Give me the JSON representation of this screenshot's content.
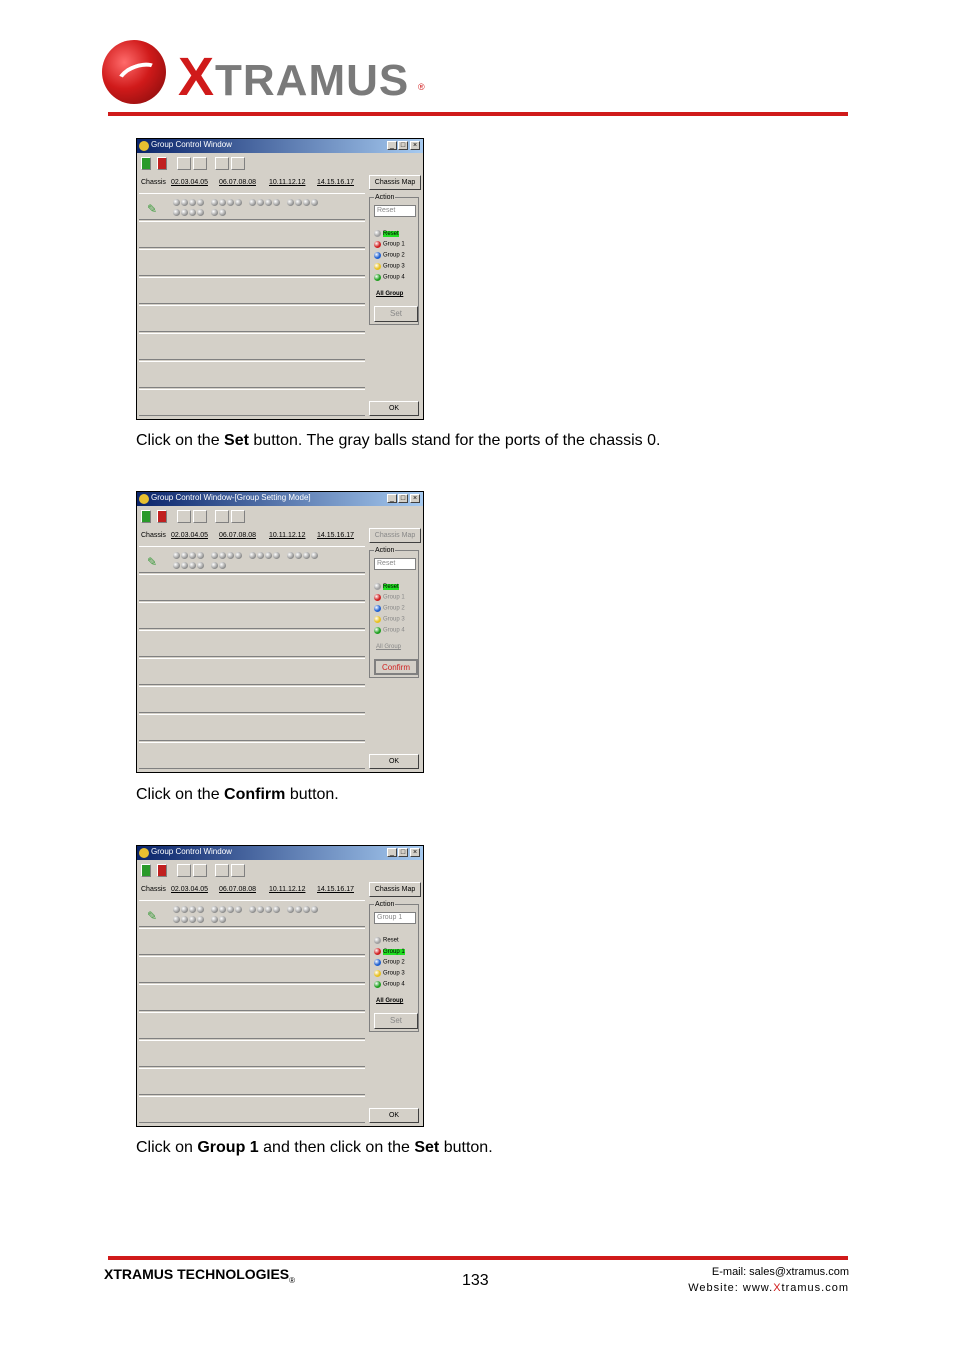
{
  "header": {
    "logo_text_x": "X",
    "logo_text_rest": "TRAMUS",
    "logo_reg": "®"
  },
  "colors": {
    "brand_red": "#d01a1a",
    "win_face": "#d4d0c8",
    "title_blue": "#0a246a"
  },
  "windows": [
    {
      "title": "Group Control Window",
      "chassis_label": "Chassis",
      "ips": [
        "02.03.04.05",
        "06.07.08.08",
        "10.11.12.12",
        "14.15.16.17"
      ],
      "chassis_map": "Chassis Map",
      "action_label": "Action",
      "action_value": "Reset",
      "radios": [
        {
          "label": "Reset",
          "color": "#a0a0a0",
          "selected": true
        },
        {
          "label": "Group 1",
          "color": "#d02020",
          "selected": false
        },
        {
          "label": "Group 2",
          "color": "#2060d0",
          "selected": false
        },
        {
          "label": "Group 3",
          "color": "#e8c020",
          "selected": false
        },
        {
          "label": "Group 4",
          "color": "#20a020",
          "selected": false
        }
      ],
      "all_group": "All Group",
      "set_button": "Set",
      "ok_button": "OK"
    },
    {
      "title": "Group Control Window-[Group Setting Mode]",
      "chassis_label": "Chassis",
      "ips": [
        "02.03.04.05",
        "06.07.08.08",
        "10.11.12.12",
        "14.15.16.17"
      ],
      "chassis_map": "Chassis Map",
      "action_label": "Action",
      "action_value": "Reset",
      "radios": [
        {
          "label": "Reset",
          "color": "#a0a0a0",
          "selected": true
        },
        {
          "label": "Group 1",
          "color": "#d02020",
          "selected": false
        },
        {
          "label": "Group 2",
          "color": "#2060d0",
          "selected": false
        },
        {
          "label": "Group 3",
          "color": "#e8c020",
          "selected": false
        },
        {
          "label": "Group 4",
          "color": "#20a020",
          "selected": false
        }
      ],
      "all_group": "All Group",
      "set_button": "Confirm",
      "ok_button": "OK"
    },
    {
      "title": "Group Control Window",
      "chassis_label": "Chassis",
      "ips": [
        "02.03.04.05",
        "06.07.08.08",
        "10.11.12.12",
        "14.15.16.17"
      ],
      "chassis_map": "Chassis Map",
      "action_label": "Action",
      "action_value": "Group 1",
      "radios": [
        {
          "label": "Reset",
          "color": "#a0a0a0",
          "selected": false
        },
        {
          "label": "Group 1",
          "color": "#d02020",
          "selected": true
        },
        {
          "label": "Group 2",
          "color": "#2060d0",
          "selected": false
        },
        {
          "label": "Group 3",
          "color": "#e8c020",
          "selected": false
        },
        {
          "label": "Group 4",
          "color": "#20a020",
          "selected": false
        }
      ],
      "all_group": "All Group",
      "set_button": "Set",
      "ok_button": "OK"
    }
  ],
  "captions": [
    {
      "pre": "Click on the ",
      "bold": "Set",
      "post": " button. The gray balls stand for the ports of the chassis 0."
    },
    {
      "pre": "Click on the ",
      "bold": "Confirm",
      "post": " button."
    },
    {
      "pre": "Click on ",
      "bold": "Group 1",
      "mid": " and then click on the ",
      "bold2": "Set",
      "post": " button."
    }
  ],
  "footer": {
    "company": "XTRAMUS TECHNOLOGIES",
    "reg": "®",
    "page": "133",
    "email": "E-mail: sales@xtramus.com",
    "web_pre": "Website:  www.",
    "web_x": "X",
    "web_post": "tramus.com"
  }
}
